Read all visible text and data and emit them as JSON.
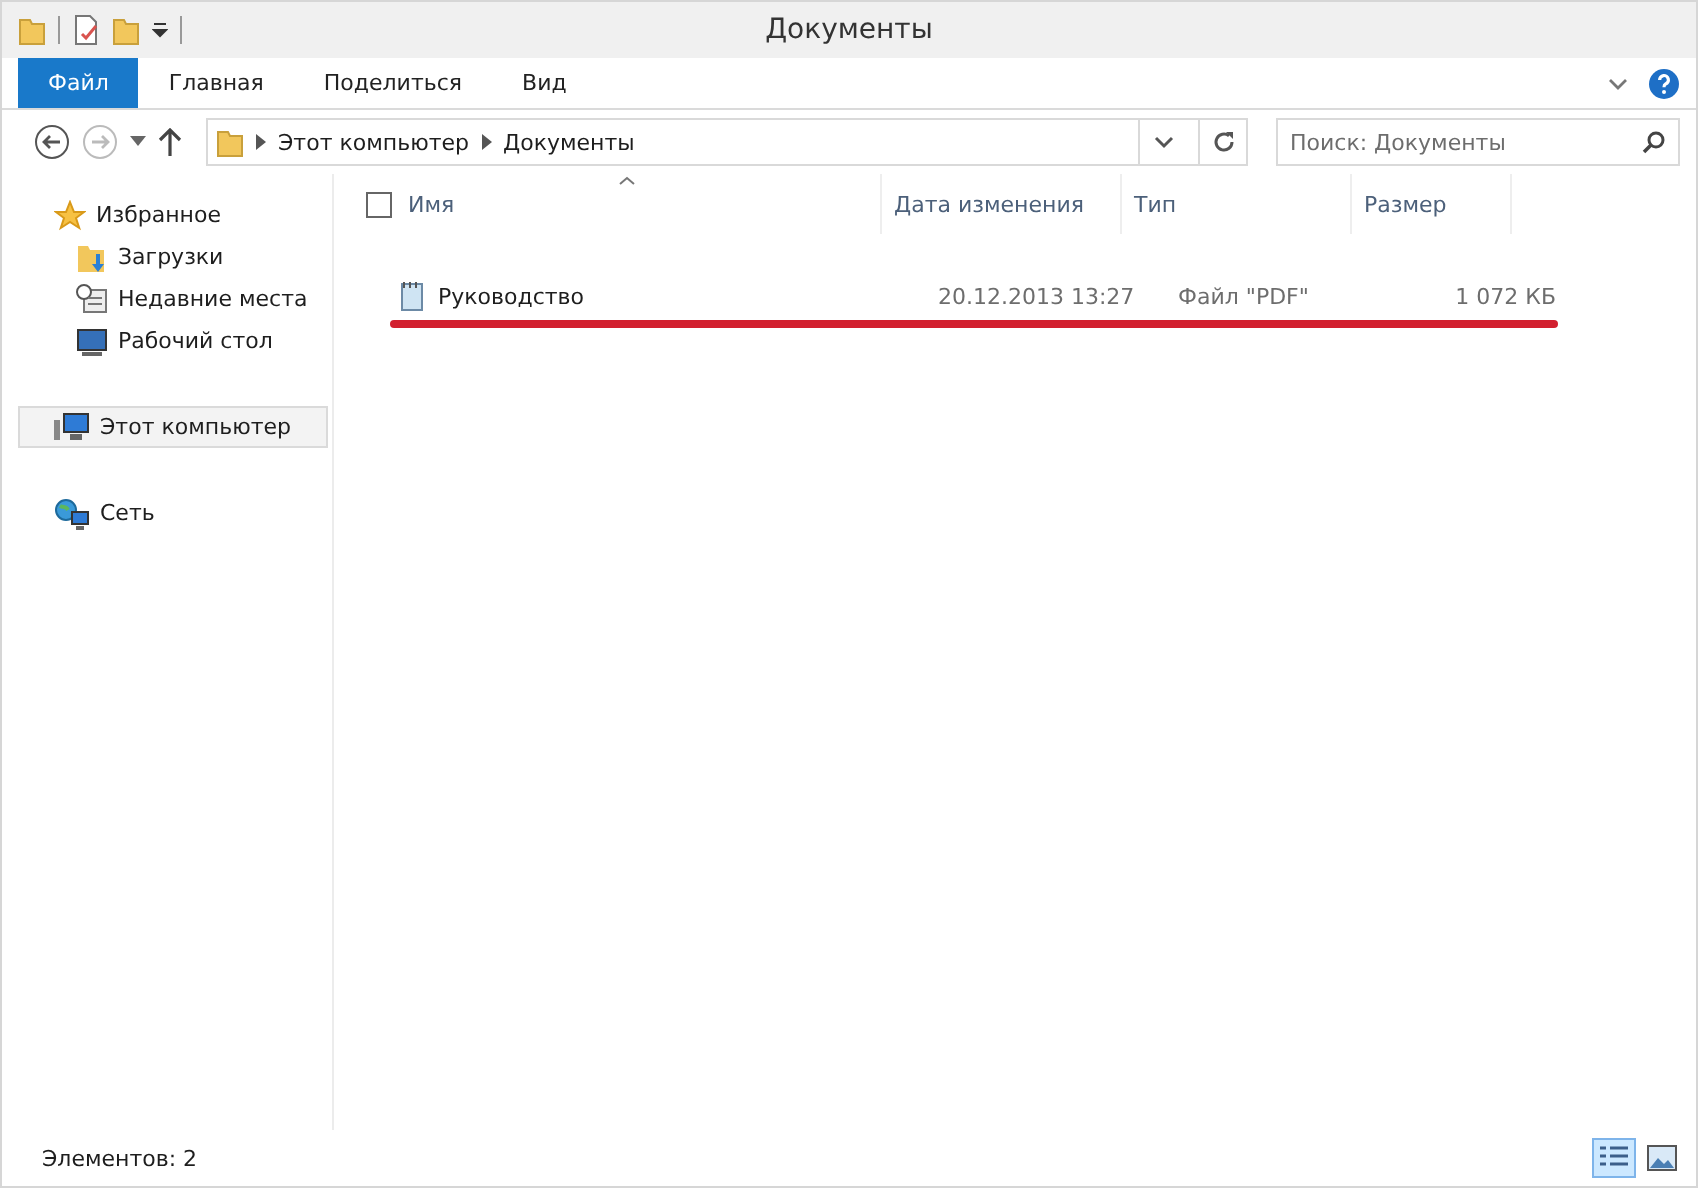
{
  "window": {
    "title": "Документы"
  },
  "ribbon_tabs": [
    {
      "label": "Файл",
      "kind": "file"
    },
    {
      "label": "Главная",
      "kind": "tab"
    },
    {
      "label": "Поделиться",
      "kind": "tab"
    },
    {
      "label": "Вид",
      "kind": "tab"
    }
  ],
  "address": {
    "segments": [
      "Этот компьютер",
      "Документы"
    ]
  },
  "search": {
    "placeholder": "Поиск: Документы"
  },
  "sidebar": {
    "items": [
      {
        "label": "Избранное",
        "kind": "star",
        "selected": false,
        "children": [
          {
            "label": "Загрузки",
            "kind": "downloads",
            "selected": false
          },
          {
            "label": "Недавние места",
            "kind": "recent",
            "selected": false
          },
          {
            "label": "Рабочий стол",
            "kind": "desktop",
            "selected": false
          }
        ]
      },
      {
        "label": "Этот компьютер",
        "kind": "computer",
        "selected": true
      },
      {
        "label": "Сеть",
        "kind": "network",
        "selected": false
      }
    ]
  },
  "table": {
    "columns": [
      "Имя",
      "Дата изменения",
      "Тип",
      "Размер"
    ],
    "rows": [
      {
        "name": "Руководство",
        "date": "20.12.2013 13:27",
        "type": "Файл \"PDF\"",
        "size": "1 072 КБ",
        "underlined": true
      }
    ]
  },
  "status_bar": {
    "text": "Элементов: 2",
    "views": [
      {
        "kind": "details",
        "selected": true
      },
      {
        "kind": "large_icons",
        "selected": false
      }
    ]
  }
}
